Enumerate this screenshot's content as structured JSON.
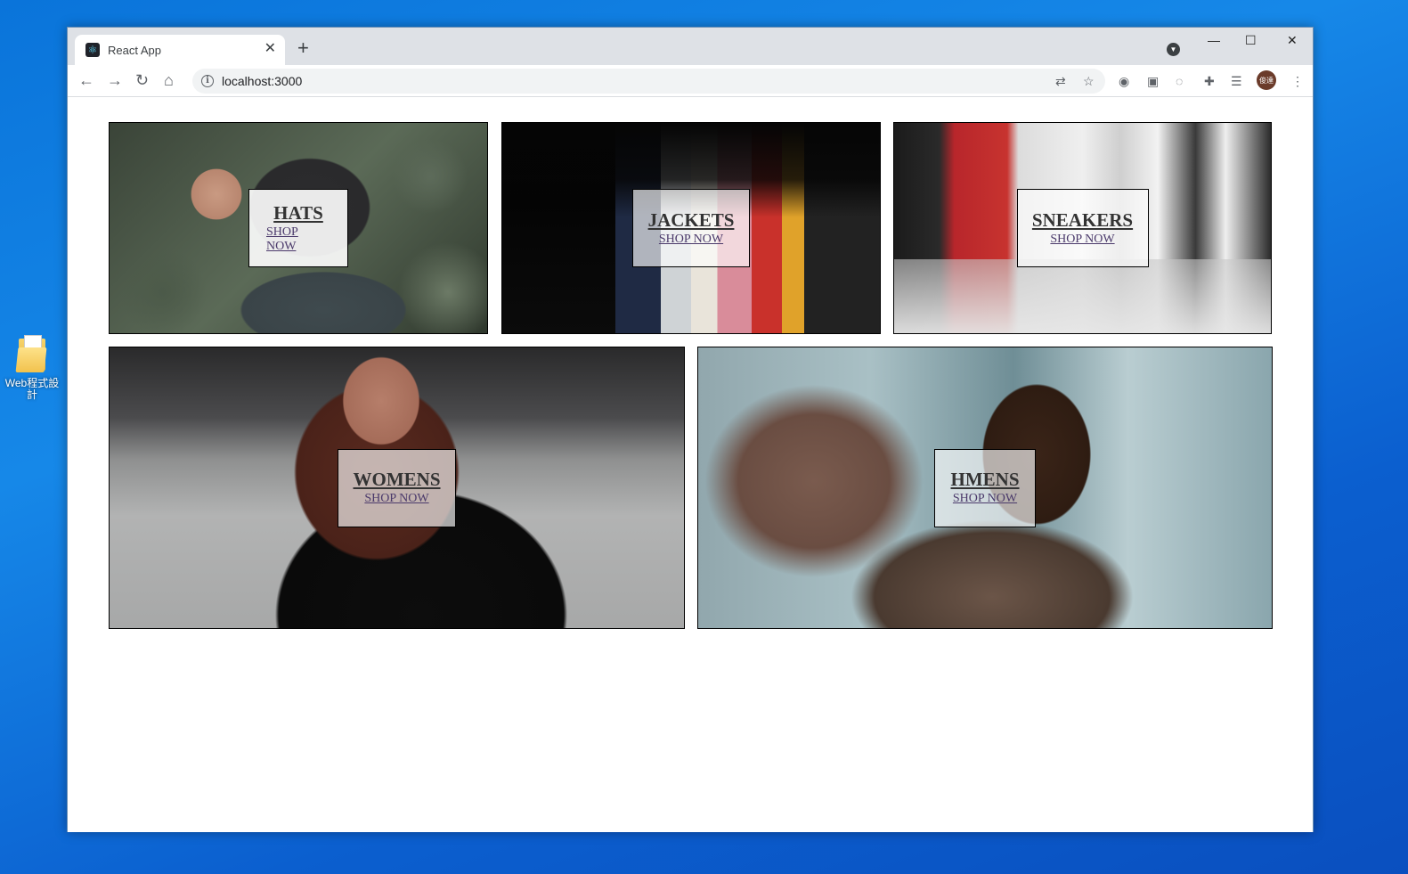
{
  "desktop": {
    "icon_label": "Web程式設計"
  },
  "browser": {
    "tab_title": "React App",
    "new_tab_symbol": "+",
    "close_symbol": "✕",
    "window_controls": [
      "—",
      "☐",
      "✕"
    ],
    "url": "localhost:3000",
    "avatar_text": "俊達"
  },
  "directory": {
    "sections": [
      {
        "title": "HATS",
        "subtitle": "SHOP NOW"
      },
      {
        "title": "JACKETS",
        "subtitle": "SHOP NOW"
      },
      {
        "title": "SNEAKERS",
        "subtitle": "SHOP NOW"
      },
      {
        "title": "WOMENS",
        "subtitle": "SHOP NOW"
      },
      {
        "title": "HMENS",
        "subtitle": "SHOP NOW"
      }
    ]
  },
  "icons": [
    "react-favicon-icon",
    "back-arrow-icon",
    "forward-arrow-icon",
    "reload-icon",
    "home-icon",
    "info-icon",
    "translate-icon",
    "star-icon",
    "extension-icon",
    "extensions-puzzle-icon",
    "reading-list-icon",
    "menu-dots-icon",
    "folder-icon"
  ]
}
